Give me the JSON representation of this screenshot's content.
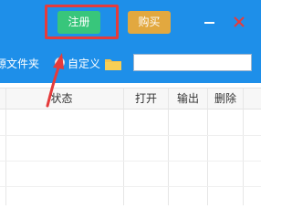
{
  "header": {
    "register_label": "注册",
    "buy_label": "购买",
    "colors": {
      "topbar": "#1e8fe9",
      "register": "#38c67b",
      "buy": "#e2a83f",
      "close": "#e53b3b",
      "highlight": "#e53b3b"
    }
  },
  "options": {
    "source_folder_label": "源文件夹",
    "custom_label": "自定义",
    "path_value": "",
    "folder_icon": "folder-icon"
  },
  "table": {
    "columns": [
      "状态",
      "打开",
      "输出",
      "删除"
    ],
    "rows": []
  },
  "annotations": {
    "highlight": "red-rectangle",
    "arrow": "red-arrow-up"
  }
}
